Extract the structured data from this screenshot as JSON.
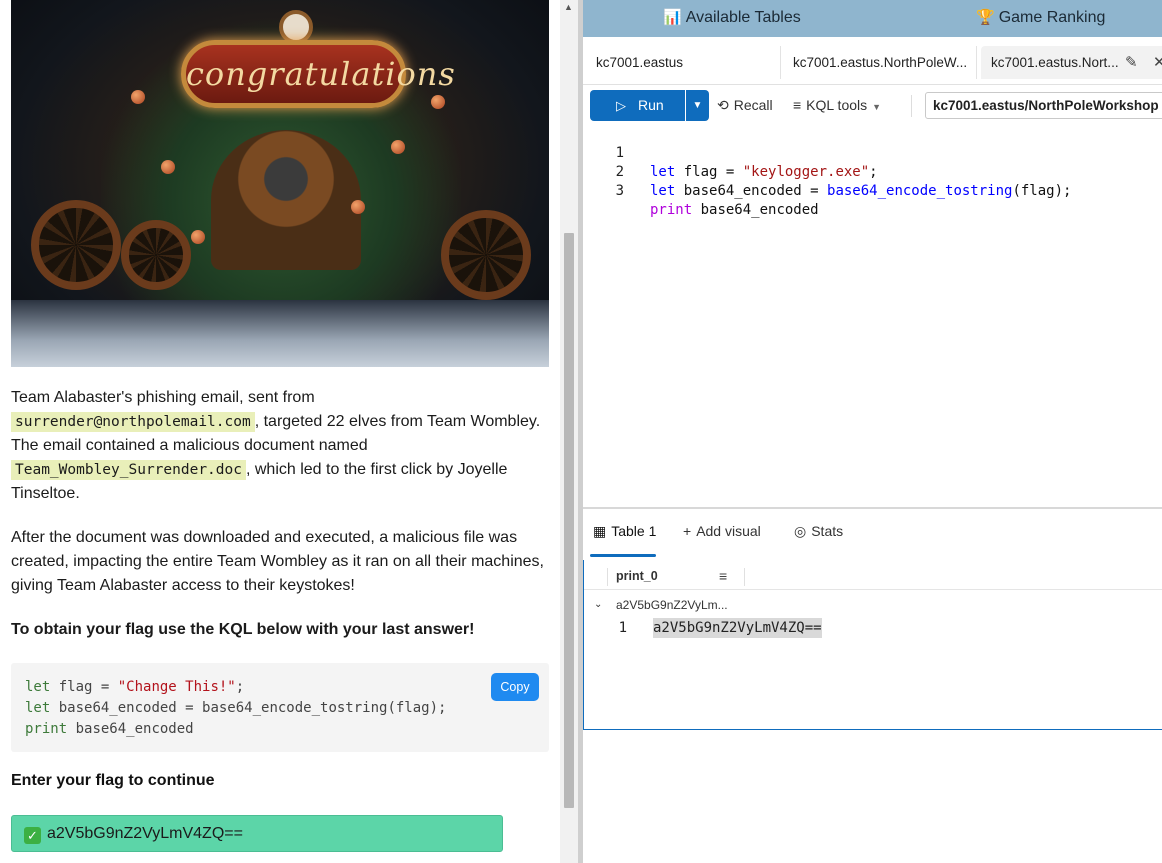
{
  "left": {
    "hero": {
      "sign_text": "congratulations"
    },
    "paragraphs": {
      "p1_pre": "Team Alabaster's phishing email, sent from ",
      "p1_email": "surrender@northpolemail.com",
      "p1_mid": ", targeted 22 elves from Team Wombley. The email contained a malicious document named ",
      "p1_doc": "Team_Wombley_Surrender.doc",
      "p1_post": ", which led to the first click by Joyelle Tinseltoe.",
      "p2": "After the document was downloaded and executed, a malicious file was created, impacting the entire Team Wombley as it ran on all their machines, giving Team Alabaster access to their keystokes!",
      "p3": "To obtain your flag use the KQL below with your last answer!"
    },
    "code_sample": {
      "l1_kw": "let",
      "l1_rest": " flag = ",
      "l1_str": "\"Change This!\"",
      "l1_end": ";",
      "l2_kw": "let",
      "l2_rest": " base64_encoded = base64_encode_tostring(flag);",
      "l3_kw": "print",
      "l3_rest": " base64_encoded"
    },
    "copy_label": "Copy",
    "enter_label": "Enter your flag to continue",
    "flag_value": "a2V5bG9nZ2VyLmV4ZQ=="
  },
  "right": {
    "topbar": {
      "tables_icon": "📊",
      "tables_label": "Available Tables",
      "ranking_icon": "🏆",
      "ranking_label": "Game Ranking"
    },
    "tabs": [
      {
        "label": "kc7001.eastus"
      },
      {
        "label": "kc7001.eastus.NorthPoleW..."
      },
      {
        "label": "kc7001.eastus.Nort..."
      }
    ],
    "toolbar": {
      "run_label": "Run",
      "recall_label": "Recall",
      "kql_tools_label": "KQL tools",
      "database": "kc7001.eastus/NorthPoleWorkshop"
    },
    "editor": {
      "lines": [
        {
          "num": "1",
          "kw": "let",
          "a": " flag = ",
          "str": "\"keylogger.exe\"",
          "b": ";"
        },
        {
          "num": "2",
          "kw": "let",
          "a": " base64_encoded = ",
          "fn": "base64_encode_tostring",
          "b": "(flag);"
        },
        {
          "num": "3",
          "kw": "print",
          "a": " base64_encoded"
        }
      ]
    },
    "results": {
      "tab_table": "Table 1",
      "tab_visual": "Add visual",
      "tab_stats": "Stats",
      "column": "print_0",
      "group_value": "a2V5bG9nZ2VyLm...",
      "row_num": "1",
      "row_value": "a2V5bG9nZ2VyLmV4ZQ=="
    }
  }
}
